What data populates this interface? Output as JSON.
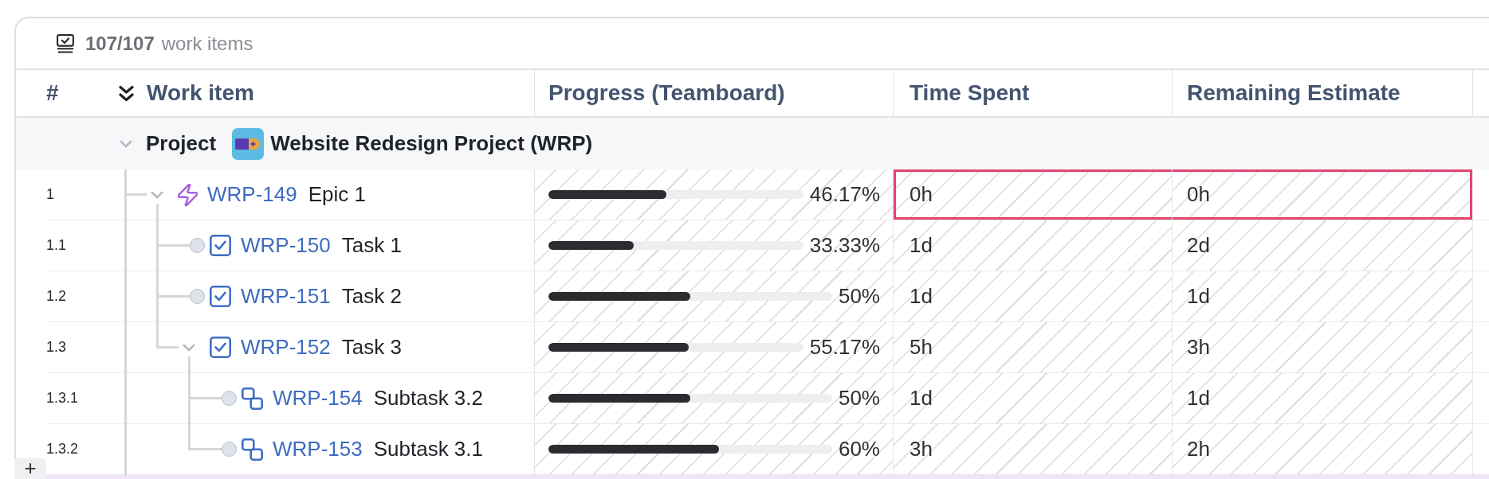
{
  "toolbar": {
    "count": "107/107",
    "label": "work items"
  },
  "columns": [
    {
      "label": "#"
    },
    {
      "label": "Work item"
    },
    {
      "label": "Progress (Teamboard)"
    },
    {
      "label": "Time Spent"
    },
    {
      "label": "Remaining Estimate"
    }
  ],
  "group": {
    "label": "Project",
    "name": "Website Redesign Project (WRP)",
    "expanded": true
  },
  "rows": [
    {
      "number": "1",
      "kind": "epic",
      "key": "WRP-149",
      "summary": "Epic 1",
      "expanded": true,
      "selected": true,
      "progress": {
        "level": 0.4617,
        "reading": "46.17%"
      },
      "time_spent": "0h",
      "remaining_estimate": "0h",
      "children": [
        {
          "number": "1.1",
          "kind": "task",
          "key": "WRP-150",
          "summary": "Task 1",
          "expanded": false,
          "selected": false,
          "progress": {
            "level": 0.3333,
            "reading": "33.33%"
          },
          "time_spent": "1d",
          "remaining_estimate": "2d"
        },
        {
          "number": "1.2",
          "kind": "task",
          "key": "WRP-151",
          "summary": "Task 2",
          "expanded": false,
          "selected": false,
          "progress": {
            "level": 0.5,
            "reading": "50%"
          },
          "time_spent": "1d",
          "remaining_estimate": "1d"
        },
        {
          "number": "1.3",
          "kind": "task",
          "key": "WRP-152",
          "summary": "Task 3",
          "expanded": true,
          "selected": false,
          "progress": {
            "level": 0.5517,
            "reading": "55.17%"
          },
          "time_spent": "5h",
          "remaining_estimate": "3h",
          "children": [
            {
              "number": "1.3.1",
              "kind": "subtask",
              "key": "WRP-154",
              "summary": "Subtask 3.2",
              "expanded": false,
              "selected": false,
              "progress": {
                "level": 0.5,
                "reading": "50%"
              },
              "time_spent": "1d",
              "remaining_estimate": "1d"
            },
            {
              "number": "1.3.2",
              "kind": "subtask",
              "key": "WRP-153",
              "summary": "Subtask 3.1",
              "expanded": false,
              "selected": false,
              "progress": {
                "level": 0.6,
                "reading": "60%"
              },
              "time_spent": "3h",
              "remaining_estimate": "2h"
            }
          ]
        }
      ]
    }
  ],
  "add_button": {
    "label": "+"
  }
}
